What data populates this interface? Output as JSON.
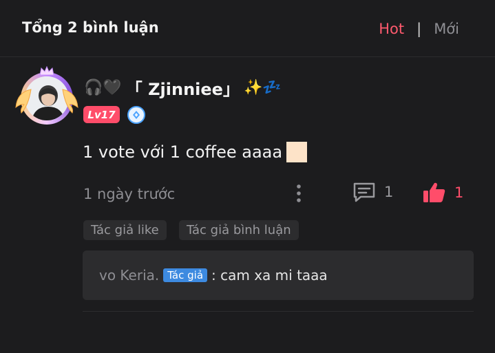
{
  "header": {
    "title": "Tổng 2 bình luận",
    "sort_hot": "Hot",
    "sort_separator": "|",
    "sort_new": "Mới"
  },
  "comment": {
    "username_prefix_emoji": "🎧🖤",
    "username": "「 Zjinniee」",
    "username_suffix_emoji": "✨💤",
    "level": "Lv17",
    "text": "1 vote với 1 coffee aaaa",
    "time": "1 ngày trước",
    "reply_count": "1",
    "like_count": "1",
    "tags": [
      "Tác giả like",
      "Tác giả bình luận"
    ]
  },
  "reply": {
    "name": "vo Keria.",
    "author_badge": "Tác giả",
    "text": ": cam xa mi taaa"
  },
  "colors": {
    "background": "#1c1c1e",
    "accent_pink": "#ff4d6a",
    "hot_color": "#ff5a6e",
    "muted": "#8e8e93",
    "panel": "#2c2c2e",
    "author_badge": "#3d8ae0"
  },
  "icons": {
    "more": "more-vertical-icon",
    "reply": "comment-icon",
    "like": "thumbs-up-icon",
    "badge": "verified-diamond-icon"
  }
}
